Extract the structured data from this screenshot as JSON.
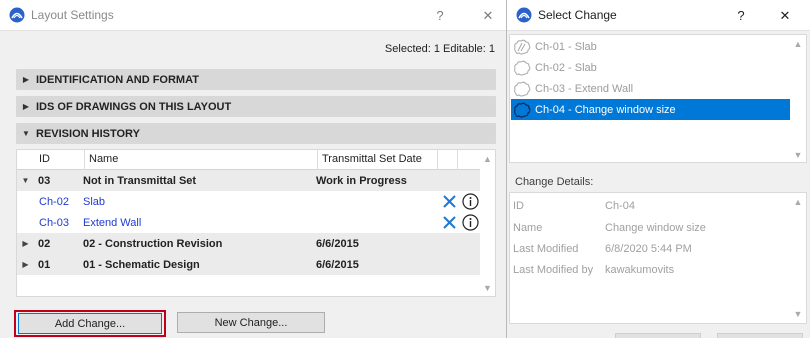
{
  "left_dialog": {
    "title": "Layout Settings",
    "help_glyph": "?",
    "close_glyph": "✕",
    "selected_info": "Selected: 1 Editable: 1",
    "sections": {
      "identification": "IDENTIFICATION AND FORMAT",
      "ids_of_drawings": "IDS OF DRAWINGS ON THIS LAYOUT",
      "revision_history": "REVISION HISTORY"
    },
    "table": {
      "headers": {
        "id": "ID",
        "name": "Name",
        "date": "Transmittal Set Date"
      },
      "rows": [
        {
          "kind": "group",
          "expanded": true,
          "id": "03",
          "name": "Not in Transmittal Set",
          "date": "Work in Progress"
        },
        {
          "kind": "item",
          "id": "Ch-02",
          "name": "Slab"
        },
        {
          "kind": "item",
          "id": "Ch-03",
          "name": "Extend Wall"
        },
        {
          "kind": "group",
          "expanded": false,
          "id": "02",
          "name": "02 - Construction Revision",
          "date": "6/6/2015"
        },
        {
          "kind": "group",
          "expanded": false,
          "id": "01",
          "name": "01 - Schematic Design",
          "date": "6/6/2015"
        }
      ]
    },
    "buttons": {
      "add_change": "Add Change...",
      "new_change": "New Change..."
    }
  },
  "right_dialog": {
    "title": "Select Change",
    "help_glyph": "?",
    "close_glyph": "✕",
    "changes": [
      {
        "label": "Ch-01 - Slab",
        "selected": false
      },
      {
        "label": "Ch-02 - Slab",
        "selected": false
      },
      {
        "label": "Ch-03 - Extend Wall",
        "selected": false
      },
      {
        "label": "Ch-04 - Change window size",
        "selected": true
      }
    ],
    "details_label": "Change Details:",
    "details": [
      {
        "key": "ID",
        "value": "Ch-04"
      },
      {
        "key": "Name",
        "value": "Change window size"
      },
      {
        "key": "Last Modified",
        "value": "6/8/2020 5:44 PM"
      },
      {
        "key": "Last Modified by",
        "value": "kawakumovits"
      }
    ]
  },
  "colors": {
    "accent": "#0078d7",
    "link_blue": "#1f3bd1",
    "focus_red": "#c0001a",
    "section_gray": "#d8d8d8"
  },
  "icons": [
    "archicad-app-icon",
    "delete-x-icon",
    "info-circle-icon",
    "cloud-change-icon",
    "triangle-right-icon",
    "triangle-down-icon",
    "scroll-up-icon",
    "scroll-down-icon"
  ]
}
